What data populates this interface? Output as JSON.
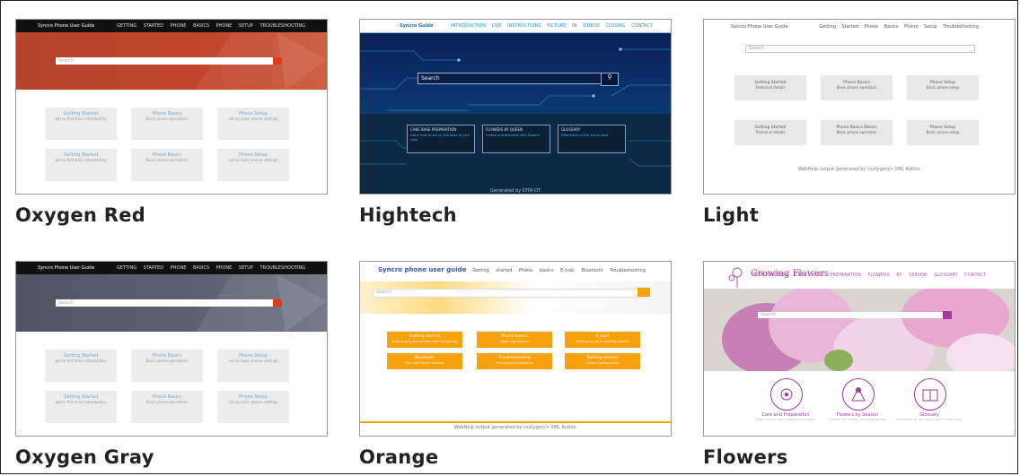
{
  "themes": [
    {
      "name": "Oxygen Red",
      "accent": "#c0452a",
      "preview": {
        "app_title": "Syncro Phone User Guide",
        "nav": "GETTING STARTED   PHONE BASICS   PHONE SETUP   TROUBLESHOOTING",
        "tiles": [
          {
            "title": "Getting Started",
            "desc": "get to first time introductory"
          },
          {
            "title": "Phone Basics",
            "desc": "Basic phone operations"
          },
          {
            "title": "Phone Setup",
            "desc": "set up basic phone settings"
          },
          {
            "title": "Getting Started",
            "desc": "get to first time introductory"
          },
          {
            "title": "Phone Basics",
            "desc": "Basic phone operations"
          },
          {
            "title": "Phone Setup",
            "desc": "set up basic phone settings"
          }
        ]
      }
    },
    {
      "name": "Hightech",
      "accent": "#0d2e6a",
      "preview": {
        "app_title": "Syncro Guide",
        "nav": "INTRODUCTION   LIVE INSTRUCTIONS   PICTURE IN VIDEOS   CLOSING   CONTACT",
        "search_text": "Search",
        "boxes": [
          {
            "title": "CAKE BASE PREPARATION",
            "desc": "Learn how to set up the base of your cake"
          },
          {
            "title": "FLOWERS BY QUEEN",
            "desc": "Create and decorate with flowers"
          },
          {
            "title": "GLOSSARY",
            "desc": "Definitions of the terms used"
          }
        ],
        "footer": "Generated by DITA-OT"
      }
    },
    {
      "name": "Light",
      "accent": "#e8e8e8",
      "preview": {
        "app_title": "Syncro Phone User Guide",
        "nav": "Getting Started   Phone Basics   Phone Setup   Troubleshooting",
        "search_text": "Search",
        "tiles": [
          {
            "title": "Getting Started",
            "desc": "Technical details"
          },
          {
            "title": "Phone Basics",
            "desc": "Basic phone operation"
          },
          {
            "title": "Phone Setup",
            "desc": "Basic phone setup"
          },
          {
            "title": "Getting Started",
            "desc": "Technical details"
          },
          {
            "title": "Phone Basics Basics",
            "desc": "Basic phone operation"
          },
          {
            "title": "Phone Setup",
            "desc": "Basic phone setup"
          }
        ],
        "footer": "WebHelp output generated by <oXygen/> XML Author"
      }
    },
    {
      "name": "Oxygen Gray",
      "accent": "#5c6272",
      "preview": {
        "app_title": "Syncro Phone User Guide",
        "nav": "GETTING STARTED   PHONE BASICS   PHONE SETUP   TROUBLESHOOTING",
        "tiles": [
          {
            "title": "Getting Started",
            "desc": "get to first time introductory"
          },
          {
            "title": "Phone Basics",
            "desc": "Basic phone operations"
          },
          {
            "title": "Phone Setup",
            "desc": "set up basic phone settings"
          },
          {
            "title": "Getting Started",
            "desc": "get to first time introductory"
          },
          {
            "title": "Phone Basics",
            "desc": "Basic phone operations"
          },
          {
            "title": "Phone Setup",
            "desc": "set up basic phone settings"
          }
        ]
      }
    },
    {
      "name": "Orange",
      "accent": "#f5a100",
      "preview": {
        "app_title": "Syncro phone user guide",
        "nav": "Getting started   Phone basics   E-mail   Bluetooth   Troubleshooting",
        "tiles": [
          {
            "title": "Getting started",
            "desc": "How to get acquainted with the phone"
          },
          {
            "title": "Phone basics",
            "desc": "Basic operations"
          },
          {
            "title": "E-mail",
            "desc": "Setting up and sending emails"
          },
          {
            "title": "Bluetooth",
            "desc": "Pair with other devices"
          },
          {
            "title": "Troubleshooting",
            "desc": "Fix common problems"
          },
          {
            "title": "Getting started",
            "desc": "Initial configuration"
          }
        ],
        "footer": "WebHelp output generated by <oXygen/> XML Author"
      }
    },
    {
      "name": "Flowers",
      "accent": "#a13a99",
      "preview": {
        "app_title": "Growing Flowers",
        "nav": "INTRODUCTION   CARE AND PREPARATION   FLOWERS BY SEASON   GLOSSARY   CONTACT",
        "features": [
          {
            "title": "Care and Preparation",
            "desc": "Basic care of your flowers and plants"
          },
          {
            "title": "Flowers by Season",
            "desc": "Choose the flowers for each season"
          },
          {
            "title": "Glossary",
            "desc": "Definitions of the terms used in the guide"
          }
        ]
      }
    }
  ]
}
